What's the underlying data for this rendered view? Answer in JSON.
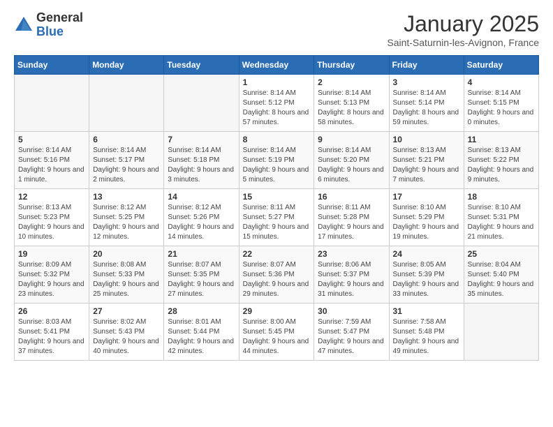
{
  "header": {
    "logo_general": "General",
    "logo_blue": "Blue",
    "month": "January 2025",
    "location": "Saint-Saturnin-les-Avignon, France"
  },
  "days_of_week": [
    "Sunday",
    "Monday",
    "Tuesday",
    "Wednesday",
    "Thursday",
    "Friday",
    "Saturday"
  ],
  "weeks": [
    [
      {
        "day": "",
        "info": ""
      },
      {
        "day": "",
        "info": ""
      },
      {
        "day": "",
        "info": ""
      },
      {
        "day": "1",
        "info": "Sunrise: 8:14 AM\nSunset: 5:12 PM\nDaylight: 8 hours and 57 minutes."
      },
      {
        "day": "2",
        "info": "Sunrise: 8:14 AM\nSunset: 5:13 PM\nDaylight: 8 hours and 58 minutes."
      },
      {
        "day": "3",
        "info": "Sunrise: 8:14 AM\nSunset: 5:14 PM\nDaylight: 8 hours and 59 minutes."
      },
      {
        "day": "4",
        "info": "Sunrise: 8:14 AM\nSunset: 5:15 PM\nDaylight: 9 hours and 0 minutes."
      }
    ],
    [
      {
        "day": "5",
        "info": "Sunrise: 8:14 AM\nSunset: 5:16 PM\nDaylight: 9 hours and 1 minute."
      },
      {
        "day": "6",
        "info": "Sunrise: 8:14 AM\nSunset: 5:17 PM\nDaylight: 9 hours and 2 minutes."
      },
      {
        "day": "7",
        "info": "Sunrise: 8:14 AM\nSunset: 5:18 PM\nDaylight: 9 hours and 3 minutes."
      },
      {
        "day": "8",
        "info": "Sunrise: 8:14 AM\nSunset: 5:19 PM\nDaylight: 9 hours and 5 minutes."
      },
      {
        "day": "9",
        "info": "Sunrise: 8:14 AM\nSunset: 5:20 PM\nDaylight: 9 hours and 6 minutes."
      },
      {
        "day": "10",
        "info": "Sunrise: 8:13 AM\nSunset: 5:21 PM\nDaylight: 9 hours and 7 minutes."
      },
      {
        "day": "11",
        "info": "Sunrise: 8:13 AM\nSunset: 5:22 PM\nDaylight: 9 hours and 9 minutes."
      }
    ],
    [
      {
        "day": "12",
        "info": "Sunrise: 8:13 AM\nSunset: 5:23 PM\nDaylight: 9 hours and 10 minutes."
      },
      {
        "day": "13",
        "info": "Sunrise: 8:12 AM\nSunset: 5:25 PM\nDaylight: 9 hours and 12 minutes."
      },
      {
        "day": "14",
        "info": "Sunrise: 8:12 AM\nSunset: 5:26 PM\nDaylight: 9 hours and 14 minutes."
      },
      {
        "day": "15",
        "info": "Sunrise: 8:11 AM\nSunset: 5:27 PM\nDaylight: 9 hours and 15 minutes."
      },
      {
        "day": "16",
        "info": "Sunrise: 8:11 AM\nSunset: 5:28 PM\nDaylight: 9 hours and 17 minutes."
      },
      {
        "day": "17",
        "info": "Sunrise: 8:10 AM\nSunset: 5:29 PM\nDaylight: 9 hours and 19 minutes."
      },
      {
        "day": "18",
        "info": "Sunrise: 8:10 AM\nSunset: 5:31 PM\nDaylight: 9 hours and 21 minutes."
      }
    ],
    [
      {
        "day": "19",
        "info": "Sunrise: 8:09 AM\nSunset: 5:32 PM\nDaylight: 9 hours and 23 minutes."
      },
      {
        "day": "20",
        "info": "Sunrise: 8:08 AM\nSunset: 5:33 PM\nDaylight: 9 hours and 25 minutes."
      },
      {
        "day": "21",
        "info": "Sunrise: 8:07 AM\nSunset: 5:35 PM\nDaylight: 9 hours and 27 minutes."
      },
      {
        "day": "22",
        "info": "Sunrise: 8:07 AM\nSunset: 5:36 PM\nDaylight: 9 hours and 29 minutes."
      },
      {
        "day": "23",
        "info": "Sunrise: 8:06 AM\nSunset: 5:37 PM\nDaylight: 9 hours and 31 minutes."
      },
      {
        "day": "24",
        "info": "Sunrise: 8:05 AM\nSunset: 5:39 PM\nDaylight: 9 hours and 33 minutes."
      },
      {
        "day": "25",
        "info": "Sunrise: 8:04 AM\nSunset: 5:40 PM\nDaylight: 9 hours and 35 minutes."
      }
    ],
    [
      {
        "day": "26",
        "info": "Sunrise: 8:03 AM\nSunset: 5:41 PM\nDaylight: 9 hours and 37 minutes."
      },
      {
        "day": "27",
        "info": "Sunrise: 8:02 AM\nSunset: 5:43 PM\nDaylight: 9 hours and 40 minutes."
      },
      {
        "day": "28",
        "info": "Sunrise: 8:01 AM\nSunset: 5:44 PM\nDaylight: 9 hours and 42 minutes."
      },
      {
        "day": "29",
        "info": "Sunrise: 8:00 AM\nSunset: 5:45 PM\nDaylight: 9 hours and 44 minutes."
      },
      {
        "day": "30",
        "info": "Sunrise: 7:59 AM\nSunset: 5:47 PM\nDaylight: 9 hours and 47 minutes."
      },
      {
        "day": "31",
        "info": "Sunrise: 7:58 AM\nSunset: 5:48 PM\nDaylight: 9 hours and 49 minutes."
      },
      {
        "day": "",
        "info": ""
      }
    ]
  ]
}
